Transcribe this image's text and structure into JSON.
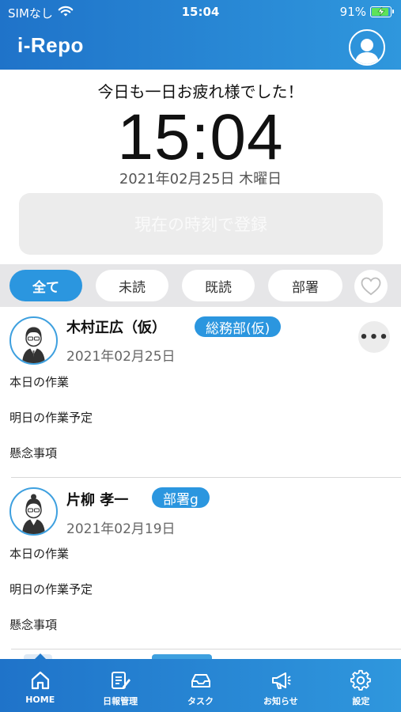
{
  "status_bar": {
    "carrier": "SIMなし",
    "time": "15:04",
    "battery": "91%",
    "battery_level": 0.91,
    "icons": [
      "wifi-icon",
      "battery-charging-icon"
    ]
  },
  "app_bar": {
    "title": "i-Repo",
    "profile_icon": "user-icon"
  },
  "greeting": "今日も一日お疲れ様でした！",
  "clock": "15:04",
  "date": "2021年02月25日 木曜日",
  "register_button": "現在の時刻で登録",
  "filters": {
    "items": [
      "全て",
      "未読",
      "既読",
      "部署"
    ],
    "active": "全て",
    "favorite_icon": "heart-icon"
  },
  "posts": [
    {
      "name": "木村正広（仮）",
      "department": "総務部(仮)",
      "date": "2021年02月25日",
      "fields": [
        "本日の作業",
        "明日の作業予定",
        "懸念事項"
      ],
      "more_icon": "more-icon"
    },
    {
      "name": "片柳 孝一",
      "department": "部署g",
      "date": "2021年02月19日",
      "fields": [
        "本日の作業",
        "明日の作業予定",
        "懸念事項"
      ]
    }
  ],
  "tabs": [
    {
      "label": "HOME",
      "icon": "home-icon",
      "active": true
    },
    {
      "label": "日報管理",
      "icon": "report-edit-icon"
    },
    {
      "label": "タスク",
      "icon": "tray-icon"
    },
    {
      "label": "お知らせ",
      "icon": "megaphone-icon"
    },
    {
      "label": "設定",
      "icon": "gear-icon"
    }
  ],
  "colors": {
    "primary": "#2b96df",
    "header_start": "#1f73c9",
    "header_end": "#2f97dd",
    "filter_bg": "#e6e6e8"
  }
}
